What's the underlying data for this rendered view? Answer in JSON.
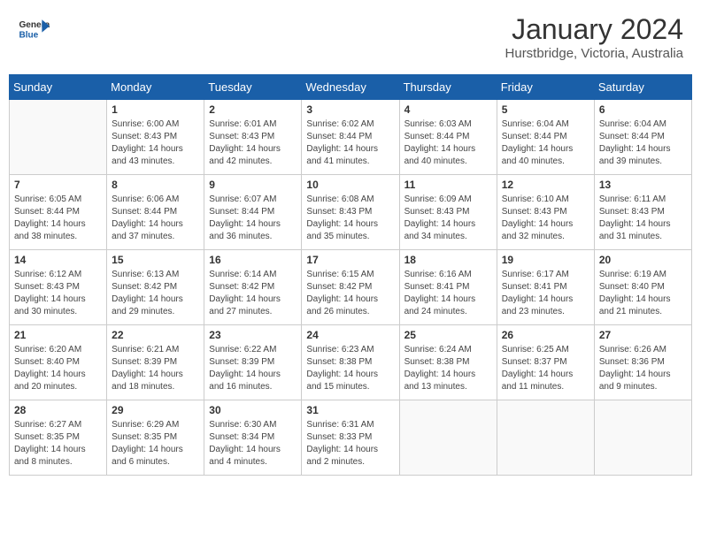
{
  "logo": {
    "line1": "General",
    "line2": "Blue"
  },
  "title": "January 2024",
  "subtitle": "Hurstbridge, Victoria, Australia",
  "days_of_week": [
    "Sunday",
    "Monday",
    "Tuesday",
    "Wednesday",
    "Thursday",
    "Friday",
    "Saturday"
  ],
  "weeks": [
    [
      {
        "day": "",
        "sunrise": "",
        "sunset": "",
        "daylight": ""
      },
      {
        "day": "1",
        "sunrise": "6:00 AM",
        "sunset": "8:43 PM",
        "daylight": "14 hours and 43 minutes."
      },
      {
        "day": "2",
        "sunrise": "6:01 AM",
        "sunset": "8:43 PM",
        "daylight": "14 hours and 42 minutes."
      },
      {
        "day": "3",
        "sunrise": "6:02 AM",
        "sunset": "8:44 PM",
        "daylight": "14 hours and 41 minutes."
      },
      {
        "day": "4",
        "sunrise": "6:03 AM",
        "sunset": "8:44 PM",
        "daylight": "14 hours and 40 minutes."
      },
      {
        "day": "5",
        "sunrise": "6:04 AM",
        "sunset": "8:44 PM",
        "daylight": "14 hours and 40 minutes."
      },
      {
        "day": "6",
        "sunrise": "6:04 AM",
        "sunset": "8:44 PM",
        "daylight": "14 hours and 39 minutes."
      }
    ],
    [
      {
        "day": "7",
        "sunrise": "6:05 AM",
        "sunset": "8:44 PM",
        "daylight": "14 hours and 38 minutes."
      },
      {
        "day": "8",
        "sunrise": "6:06 AM",
        "sunset": "8:44 PM",
        "daylight": "14 hours and 37 minutes."
      },
      {
        "day": "9",
        "sunrise": "6:07 AM",
        "sunset": "8:44 PM",
        "daylight": "14 hours and 36 minutes."
      },
      {
        "day": "10",
        "sunrise": "6:08 AM",
        "sunset": "8:43 PM",
        "daylight": "14 hours and 35 minutes."
      },
      {
        "day": "11",
        "sunrise": "6:09 AM",
        "sunset": "8:43 PM",
        "daylight": "14 hours and 34 minutes."
      },
      {
        "day": "12",
        "sunrise": "6:10 AM",
        "sunset": "8:43 PM",
        "daylight": "14 hours and 32 minutes."
      },
      {
        "day": "13",
        "sunrise": "6:11 AM",
        "sunset": "8:43 PM",
        "daylight": "14 hours and 31 minutes."
      }
    ],
    [
      {
        "day": "14",
        "sunrise": "6:12 AM",
        "sunset": "8:43 PM",
        "daylight": "14 hours and 30 minutes."
      },
      {
        "day": "15",
        "sunrise": "6:13 AM",
        "sunset": "8:42 PM",
        "daylight": "14 hours and 29 minutes."
      },
      {
        "day": "16",
        "sunrise": "6:14 AM",
        "sunset": "8:42 PM",
        "daylight": "14 hours and 27 minutes."
      },
      {
        "day": "17",
        "sunrise": "6:15 AM",
        "sunset": "8:42 PM",
        "daylight": "14 hours and 26 minutes."
      },
      {
        "day": "18",
        "sunrise": "6:16 AM",
        "sunset": "8:41 PM",
        "daylight": "14 hours and 24 minutes."
      },
      {
        "day": "19",
        "sunrise": "6:17 AM",
        "sunset": "8:41 PM",
        "daylight": "14 hours and 23 minutes."
      },
      {
        "day": "20",
        "sunrise": "6:19 AM",
        "sunset": "8:40 PM",
        "daylight": "14 hours and 21 minutes."
      }
    ],
    [
      {
        "day": "21",
        "sunrise": "6:20 AM",
        "sunset": "8:40 PM",
        "daylight": "14 hours and 20 minutes."
      },
      {
        "day": "22",
        "sunrise": "6:21 AM",
        "sunset": "8:39 PM",
        "daylight": "14 hours and 18 minutes."
      },
      {
        "day": "23",
        "sunrise": "6:22 AM",
        "sunset": "8:39 PM",
        "daylight": "14 hours and 16 minutes."
      },
      {
        "day": "24",
        "sunrise": "6:23 AM",
        "sunset": "8:38 PM",
        "daylight": "14 hours and 15 minutes."
      },
      {
        "day": "25",
        "sunrise": "6:24 AM",
        "sunset": "8:38 PM",
        "daylight": "14 hours and 13 minutes."
      },
      {
        "day": "26",
        "sunrise": "6:25 AM",
        "sunset": "8:37 PM",
        "daylight": "14 hours and 11 minutes."
      },
      {
        "day": "27",
        "sunrise": "6:26 AM",
        "sunset": "8:36 PM",
        "daylight": "14 hours and 9 minutes."
      }
    ],
    [
      {
        "day": "28",
        "sunrise": "6:27 AM",
        "sunset": "8:35 PM",
        "daylight": "14 hours and 8 minutes."
      },
      {
        "day": "29",
        "sunrise": "6:29 AM",
        "sunset": "8:35 PM",
        "daylight": "14 hours and 6 minutes."
      },
      {
        "day": "30",
        "sunrise": "6:30 AM",
        "sunset": "8:34 PM",
        "daylight": "14 hours and 4 minutes."
      },
      {
        "day": "31",
        "sunrise": "6:31 AM",
        "sunset": "8:33 PM",
        "daylight": "14 hours and 2 minutes."
      },
      {
        "day": "",
        "sunrise": "",
        "sunset": "",
        "daylight": ""
      },
      {
        "day": "",
        "sunrise": "",
        "sunset": "",
        "daylight": ""
      },
      {
        "day": "",
        "sunrise": "",
        "sunset": "",
        "daylight": ""
      }
    ]
  ],
  "labels": {
    "sunrise_prefix": "Sunrise: ",
    "sunset_prefix": "Sunset: ",
    "daylight_prefix": "Daylight: "
  }
}
